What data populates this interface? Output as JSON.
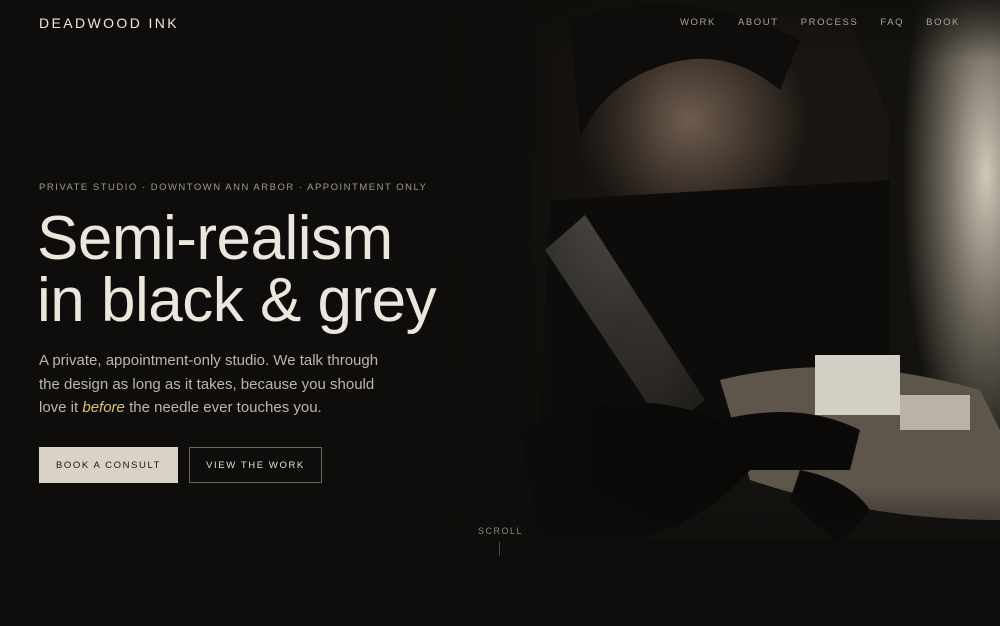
{
  "nav": {
    "brand": "DEADWOOD INK",
    "items": [
      {
        "label": "WORK"
      },
      {
        "label": "ABOUT"
      },
      {
        "label": "PROCESS"
      },
      {
        "label": "FAQ"
      },
      {
        "label": "BOOK"
      }
    ]
  },
  "hero": {
    "eyebrow": "PRIVATE STUDIO · DOWNTOWN ANN ARBOR · APPOINTMENT ONLY",
    "headline_line1": "Semi-realism",
    "headline_line2": "in black & grey",
    "lede_before": "A private, appointment-only studio. We talk through the design as long as it takes, because you should love it ",
    "lede_em": "before",
    "lede_after": " the needle ever touches you.",
    "primary_cta": "BOOK A CONSULT",
    "secondary_cta": "VIEW THE WORK",
    "scroll_label": "SCROLL",
    "photo_icon": "tattoo-artist-photo"
  },
  "colors": {
    "background": "#0e0d0b",
    "text": "#ece7dd",
    "accent": "#d8c27a",
    "button_fill": "#d9d3c7"
  }
}
